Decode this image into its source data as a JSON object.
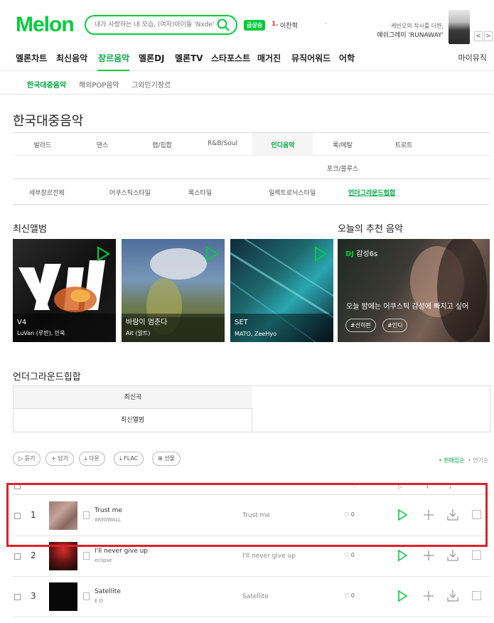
{
  "header": {
    "logo": "Melon",
    "search_placeholder": "내가 사랑하는 내 모습, (여자)아이들 'Nxde'",
    "live_badge": "급상승",
    "rank_num": "1.",
    "rank_word": "이찬혁",
    "rank_dash": "-",
    "promo_sub": "케빈오의 작사를 더한,",
    "promo_title": "애쉬그레이 'RUNAWAY'",
    "promo_prev": "<",
    "promo_next": ">"
  },
  "gnb": {
    "items": [
      "멜론차트",
      "최신음악",
      "장르음악",
      "멜론DJ",
      "멜론TV",
      "스타포스트",
      "매거진",
      "뮤직어워드",
      "어학"
    ],
    "mymusic": "마이뮤직"
  },
  "subnav": {
    "items": [
      "한국대중음악",
      "해외POP음악",
      "그외인기장르"
    ]
  },
  "page_title": "한국대중음악",
  "genres": {
    "row1": [
      "발라드",
      "댄스",
      "랩/힙합",
      "R&B/Soul",
      "인디음악",
      "록/메탈",
      "트로트"
    ],
    "row2": [
      "포크/블루스"
    ],
    "sub": [
      "세부장르전체",
      "어쿠스틱스타일",
      "록스타일",
      "일렉트로닉스타일",
      "언더그라운드힙합"
    ]
  },
  "latest_albums": {
    "title": "최신앨범",
    "items": [
      {
        "title": "V4",
        "artist": "LuVan (루반), 민욱"
      },
      {
        "title": "바람이 멈춘다",
        "artist": "Ait (알트)"
      },
      {
        "title": "SET",
        "artist": "MATO, ZeeHyo"
      }
    ]
  },
  "recommend": {
    "title": "오늘의 추천 음악",
    "dj_prefix": "DJ",
    "dj_name": "감성6s",
    "headline": "오늘 밤에는 어쿠스틱 감성에 빠지고 싶어",
    "tags": [
      "#선히판",
      "#인디"
    ]
  },
  "genre_section": {
    "title": "언더그라운드힙합",
    "tab_latest_song": "최신곡",
    "tab_latest_album": "최신앨범"
  },
  "actions": {
    "listen": "▷ 듣기",
    "add": "+ 담기",
    "download": "다운",
    "flac": "FLAC",
    "gift": "선물",
    "sort_popular": "• 판매임순",
    "sort_date": "• 연기순"
  },
  "songs": [
    {
      "rank": "1",
      "title": "Trust me",
      "artist": "WOOWALL",
      "album": "Trust me",
      "likes": "0"
    },
    {
      "rank": "2",
      "title": "I'll never give up",
      "artist": "eclipse",
      "album": "I'll never give up",
      "likes": "0"
    },
    {
      "rank": "3",
      "title": "Satellite",
      "artist": "E.O",
      "album": "Satellite",
      "likes": "0"
    }
  ],
  "colors": {
    "brand": "#00cd3c",
    "active": "#00a83e",
    "highlight": "#e0202a"
  }
}
